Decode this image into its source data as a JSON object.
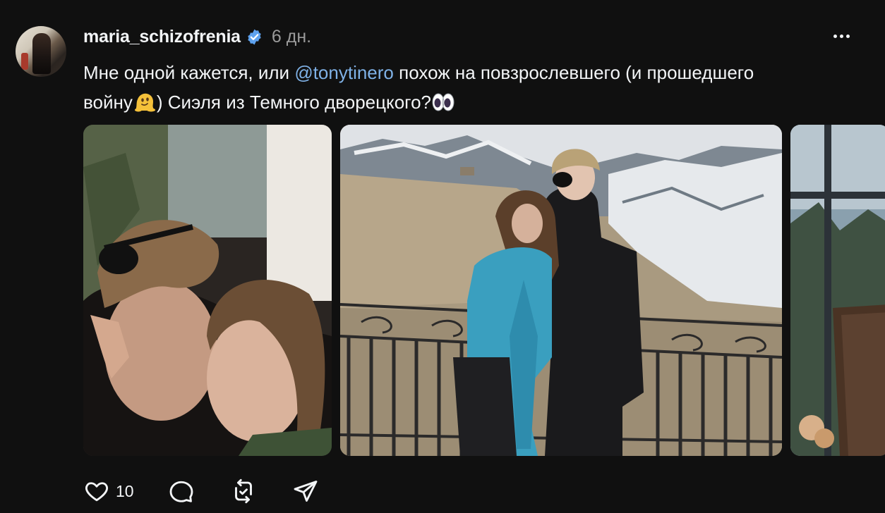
{
  "post": {
    "username": "maria_schizofrenia",
    "verified": true,
    "time": "6 дн.",
    "text_before": "Мне одной кажется, или ",
    "mention": "@tonytinero",
    "text_mid": " похож на повзрослевшего (и прошедшего войну",
    "text_after": ") Сиэля из Темного дворецкого?",
    "emoji_1": "melting-face-emoji",
    "emoji_2": "eyes-emoji",
    "like_count": "10"
  },
  "icons": {
    "verified": "verified-badge-icon",
    "more": "more-dots-icon",
    "like": "heart-icon",
    "comment": "comment-bubble-icon",
    "repost": "repost-icon",
    "share": "send-icon"
  },
  "colors": {
    "background": "#101010",
    "text": "#f3f5f7",
    "muted": "#9a9a9a",
    "mention": "#7fb1e6",
    "verified": "#0095f6"
  }
}
